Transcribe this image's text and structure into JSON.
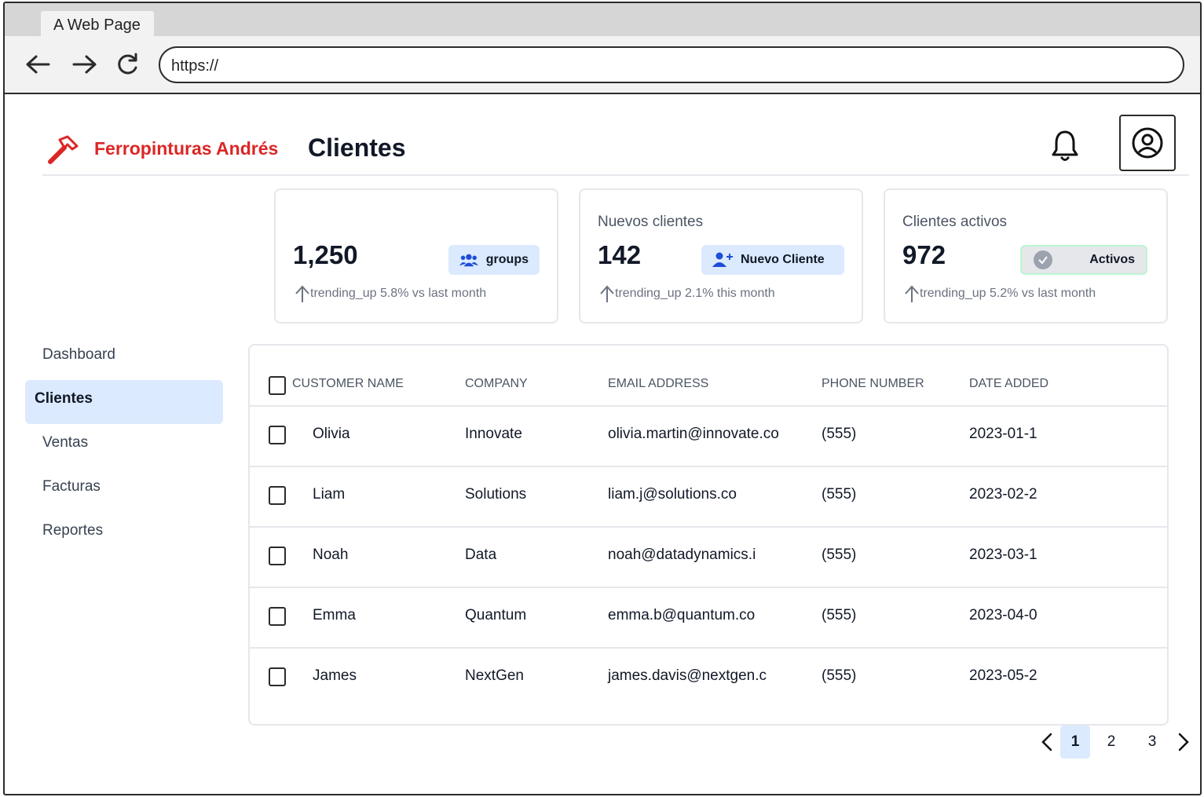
{
  "browser": {
    "tab_title": "A Web Page",
    "url": "https://"
  },
  "header": {
    "brand": "Ferropinturas Andrés",
    "title": "Clientes",
    "brand_color": "#dc2626"
  },
  "stats": [
    {
      "label": "",
      "value": "1,250",
      "badge": "groups",
      "badge_icon": "groups-icon",
      "trend": "trending_up 5.8% vs last month"
    },
    {
      "label": "Nuevos clientes",
      "value": "142",
      "badge": "Nuevo Cliente",
      "badge_icon": "person-add-icon",
      "trend": "trending_up 2.1% this month"
    },
    {
      "label": "Clientes activos",
      "value": "972",
      "badge": "Activos",
      "badge_icon": "check-circle-icon",
      "trend": "trending_up 5.2% vs last month"
    }
  ],
  "sidebar": {
    "items": [
      {
        "label": "Dashboard",
        "active": false
      },
      {
        "label": "Clientes",
        "active": true
      },
      {
        "label": "Ventas",
        "active": false
      },
      {
        "label": "Facturas",
        "active": false
      },
      {
        "label": "Reportes",
        "active": false
      }
    ]
  },
  "table": {
    "columns": [
      "CUSTOMER NAME",
      "COMPANY",
      "EMAIL ADDRESS",
      "PHONE NUMBER",
      "DATE ADDED"
    ],
    "rows": [
      {
        "name": "Olivia",
        "company": "Innovate",
        "email": "olivia.martin@innovate.co",
        "phone": "(555)",
        "date": "2023-01-1"
      },
      {
        "name": "Liam",
        "company": "Solutions",
        "email": "liam.j@solutions.co",
        "phone": "(555)",
        "date": "2023-02-2"
      },
      {
        "name": "Noah",
        "company": "Data",
        "email": "noah@datadynamics.i",
        "phone": "(555)",
        "date": "2023-03-1"
      },
      {
        "name": "Emma",
        "company": "Quantum",
        "email": "emma.b@quantum.co",
        "phone": "(555)",
        "date": "2023-04-0"
      },
      {
        "name": "James",
        "company": "NextGen",
        "email": "james.davis@nextgen.c",
        "phone": "(555)",
        "date": "2023-05-2"
      }
    ]
  },
  "pagination": {
    "pages": [
      "1",
      "2",
      "3"
    ],
    "current": "1"
  },
  "colors": {
    "accent_light": "#dbeafe",
    "border": "#e5e7eb",
    "icon_blue": "#1d4ed8"
  }
}
